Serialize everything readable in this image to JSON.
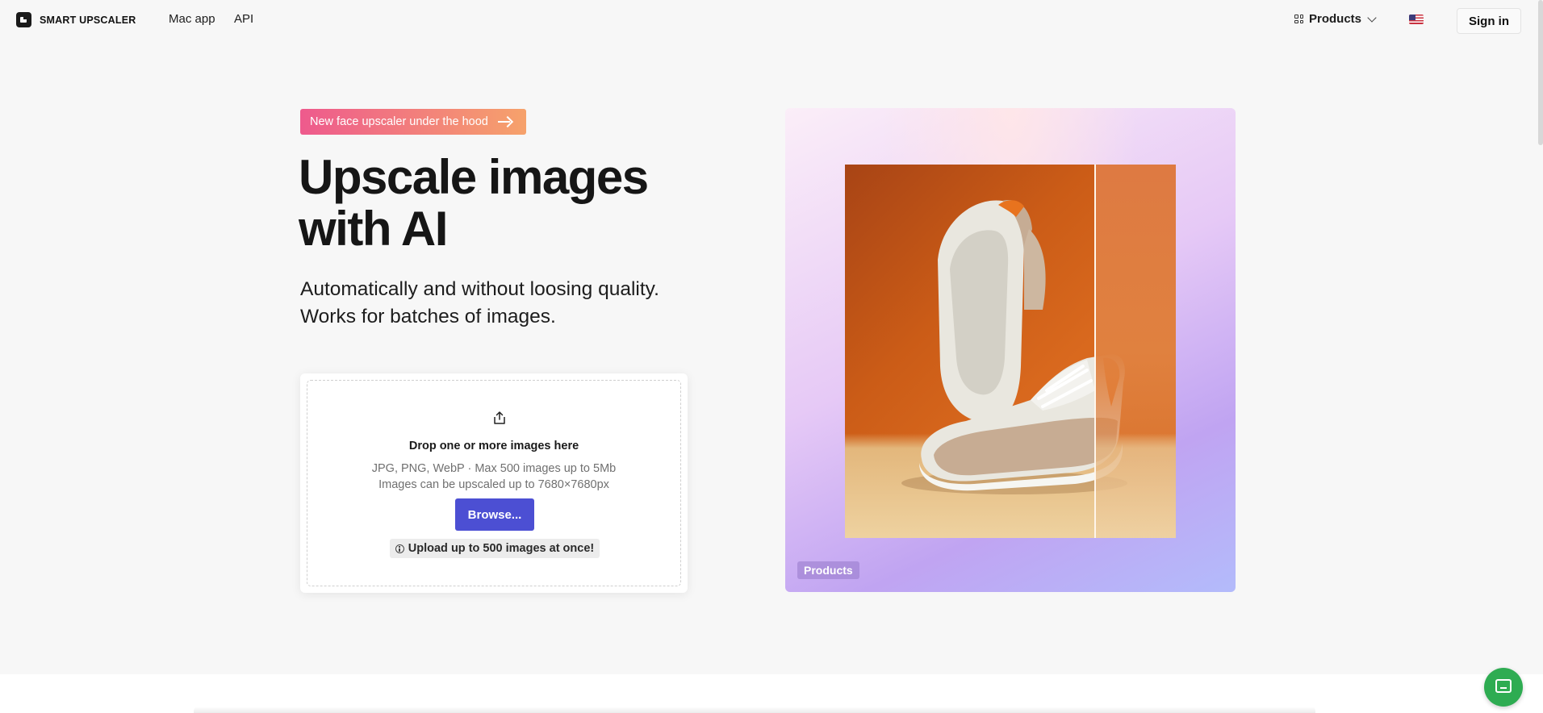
{
  "header": {
    "logo_text": "SMART UPSCALER",
    "nav": [
      "Mac app",
      "API"
    ],
    "products_label": "Products",
    "signin_label": "Sign in"
  },
  "promo": {
    "label": "New face upscaler under the hood"
  },
  "hero": {
    "title_line1": "Upscale images",
    "title_line2": "with AI",
    "subtitle_line1": "Automatically and without loosing quality.",
    "subtitle_line2": "Works for batches of images."
  },
  "upload": {
    "title": "Drop one or more images here",
    "note_line1": "JPG, PNG, WebP · Max 500 images up to 5Mb",
    "note_line2": "Images can be upscaled up to 7680×7680px",
    "browse_label": "Browse...",
    "tip": "Upload up to 500 images at once!"
  },
  "showcase": {
    "tag": "Products"
  },
  "colors": {
    "accent": "#4c4fd3",
    "promo_start": "#ee5a8d",
    "promo_end": "#f6a26b",
    "chat": "#2eac52"
  }
}
